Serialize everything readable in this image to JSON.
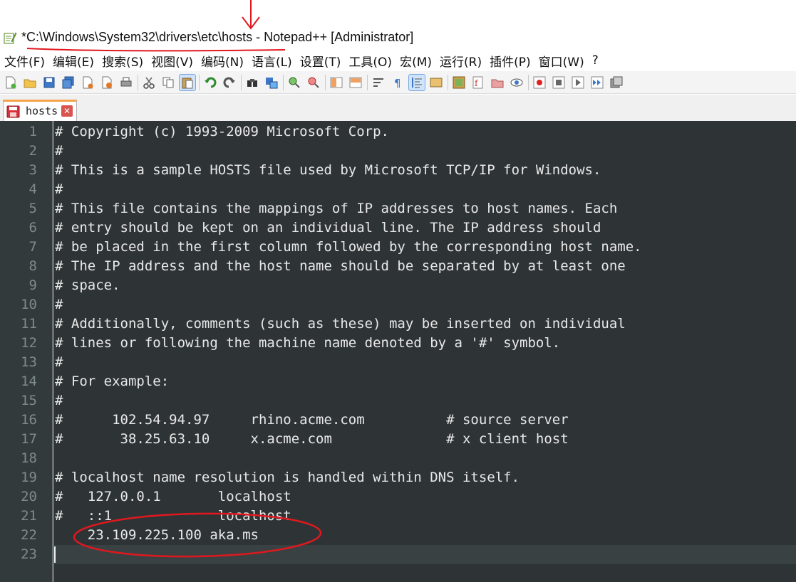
{
  "window": {
    "title": "*C:\\Windows\\System32\\drivers\\etc\\hosts - Notepad++ [Administrator]"
  },
  "menu": [
    "文件(F)",
    "编辑(E)",
    "搜索(S)",
    "视图(V)",
    "编码(N)",
    "语言(L)",
    "设置(T)",
    "工具(O)",
    "宏(M)",
    "运行(R)",
    "插件(P)",
    "窗口(W)",
    "?"
  ],
  "toolbar": {
    "icons": [
      "new-file-icon",
      "open-file-icon",
      "save-icon",
      "save-all-icon",
      "close-icon",
      "close-all-icon",
      "print-icon",
      "cut-icon",
      "copy-icon",
      "paste-icon",
      "undo-icon",
      "redo-icon",
      "find-icon",
      "replace-icon",
      "zoom-in-icon",
      "zoom-out-icon",
      "sync-vertical-icon",
      "sync-horizontal-icon",
      "word-wrap-icon",
      "show-all-chars-icon",
      "indent-guide-icon",
      "user-language-icon",
      "document-map-icon",
      "function-list-icon",
      "folder-workspace-icon",
      "monitoring-icon",
      "record-macro-icon",
      "stop-macro-icon",
      "play-macro-icon",
      "run-macro-multiple-icon",
      "save-macro-icon"
    ]
  },
  "tabs": [
    {
      "label": "hosts",
      "icon": "unsaved-file-icon",
      "active": true
    }
  ],
  "editor": {
    "lines": [
      {
        "n": "1",
        "text": "# Copyright (c) 1993-2009 Microsoft Corp."
      },
      {
        "n": "2",
        "text": "#"
      },
      {
        "n": "3",
        "text": "# This is a sample HOSTS file used by Microsoft TCP/IP for Windows."
      },
      {
        "n": "4",
        "text": "#"
      },
      {
        "n": "5",
        "text": "# This file contains the mappings of IP addresses to host names. Each"
      },
      {
        "n": "6",
        "text": "# entry should be kept on an individual line. The IP address should"
      },
      {
        "n": "7",
        "text": "# be placed in the first column followed by the corresponding host name."
      },
      {
        "n": "8",
        "text": "# The IP address and the host name should be separated by at least one"
      },
      {
        "n": "9",
        "text": "# space."
      },
      {
        "n": "10",
        "text": "#"
      },
      {
        "n": "11",
        "text": "# Additionally, comments (such as these) may be inserted on individual"
      },
      {
        "n": "12",
        "text": "# lines or following the machine name denoted by a '#' symbol."
      },
      {
        "n": "13",
        "text": "#"
      },
      {
        "n": "14",
        "text": "# For example:"
      },
      {
        "n": "15",
        "text": "#"
      },
      {
        "n": "16",
        "text": "#      102.54.94.97     rhino.acme.com          # source server"
      },
      {
        "n": "17",
        "text": "#       38.25.63.10     x.acme.com              # x client host"
      },
      {
        "n": "18",
        "text": ""
      },
      {
        "n": "19",
        "text": "# localhost name resolution is handled within DNS itself."
      },
      {
        "n": "20",
        "text": "#   127.0.0.1       localhost"
      },
      {
        "n": "21",
        "text": "#   ::1             localhost"
      },
      {
        "n": "22",
        "text": "    23.109.225.100 aka.ms"
      },
      {
        "n": "23",
        "text": ""
      }
    ],
    "current_line": 23
  },
  "colors": {
    "editor_bg": "#2e3436",
    "gutter_bg": "#333a3c",
    "line_number": "#7f8a8c",
    "text": "#e8e8e8",
    "annotation": "#e0181e",
    "tab_accent": "#f4a34a"
  }
}
